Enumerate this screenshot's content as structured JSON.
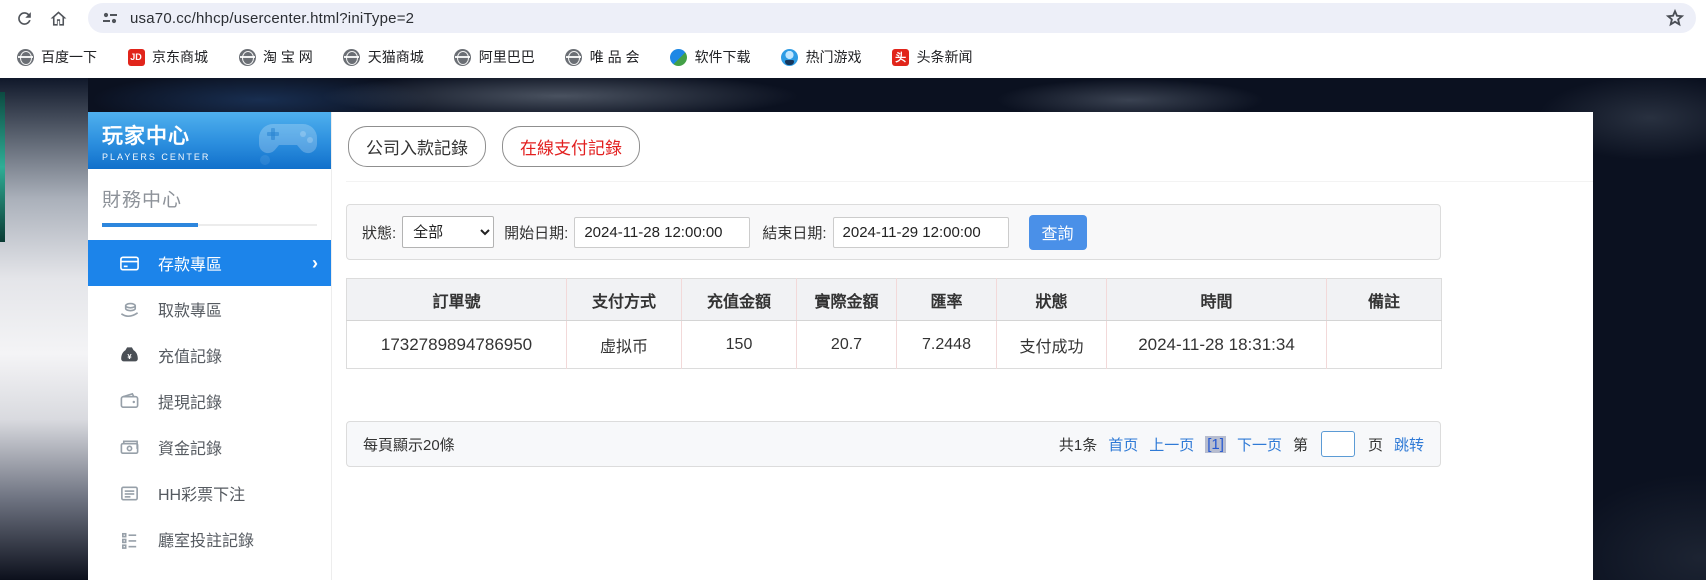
{
  "browser": {
    "url": "usa70.cc/hhcp/usercenter.html?iniType=2",
    "bookmarks": [
      {
        "label": "百度一下",
        "icon": "globe"
      },
      {
        "label": "京东商城",
        "icon": "jd-logo",
        "badge": "JD"
      },
      {
        "label": "淘 宝 网",
        "icon": "globe"
      },
      {
        "label": "天猫商城",
        "icon": "globe"
      },
      {
        "label": "阿里巴巴",
        "icon": "globe"
      },
      {
        "label": "唯 品 会",
        "icon": "globe"
      },
      {
        "label": "软件下载",
        "icon": "software"
      },
      {
        "label": "热门游戏",
        "icon": "game"
      },
      {
        "label": "头条新闻",
        "icon": "toutiao",
        "badge": "头"
      }
    ]
  },
  "sidebar": {
    "title": "玩家中心",
    "subtitle": "PLAYERS CENTER",
    "section": "財務中心",
    "chevron": "›",
    "items": [
      {
        "label": "存款專區"
      },
      {
        "label": "取款專區"
      },
      {
        "label": "充值記錄"
      },
      {
        "label": "提現記錄"
      },
      {
        "label": "資金記錄"
      },
      {
        "label": "HH彩票下注"
      },
      {
        "label": "廳室投註記錄"
      }
    ]
  },
  "main": {
    "tabs": [
      {
        "label": "公司入款記錄",
        "active": false
      },
      {
        "label": "在線支付記錄",
        "active": true
      }
    ],
    "filters": {
      "status_label": "狀態:",
      "status_value": "全部",
      "start_label": "開始日期:",
      "start_value": "2024-11-28 12:00:00",
      "end_label": "結束日期:",
      "end_value": "2024-11-29 12:00:00",
      "search_button": "查詢"
    },
    "table": {
      "headers": [
        "訂單號",
        "支付方式",
        "充值金額",
        "實際金額",
        "匯率",
        "狀態",
        "時間",
        "備註"
      ],
      "rows": [
        [
          "1732789894786950",
          "虚拟币",
          "150",
          "20.7",
          "7.2448",
          "支付成功",
          "2024-11-28 18:31:34",
          ""
        ]
      ]
    },
    "pagination": {
      "page_size_text": "每頁顯示20條",
      "total_text": "共1条",
      "first": "首页",
      "prev": "上一页",
      "current": "[1]",
      "next": "下一页",
      "goto_prefix": "第",
      "goto_suffix": "页",
      "goto_button": "跳转"
    }
  },
  "colors": {
    "accent_blue": "#1c84ea",
    "button_blue": "#4a90e8",
    "link_blue": "#2f7ad6",
    "tab_active_red": "#e21f1f",
    "header_gradient_top": "#4fb0ee",
    "header_gradient_bottom": "#1170cb"
  }
}
